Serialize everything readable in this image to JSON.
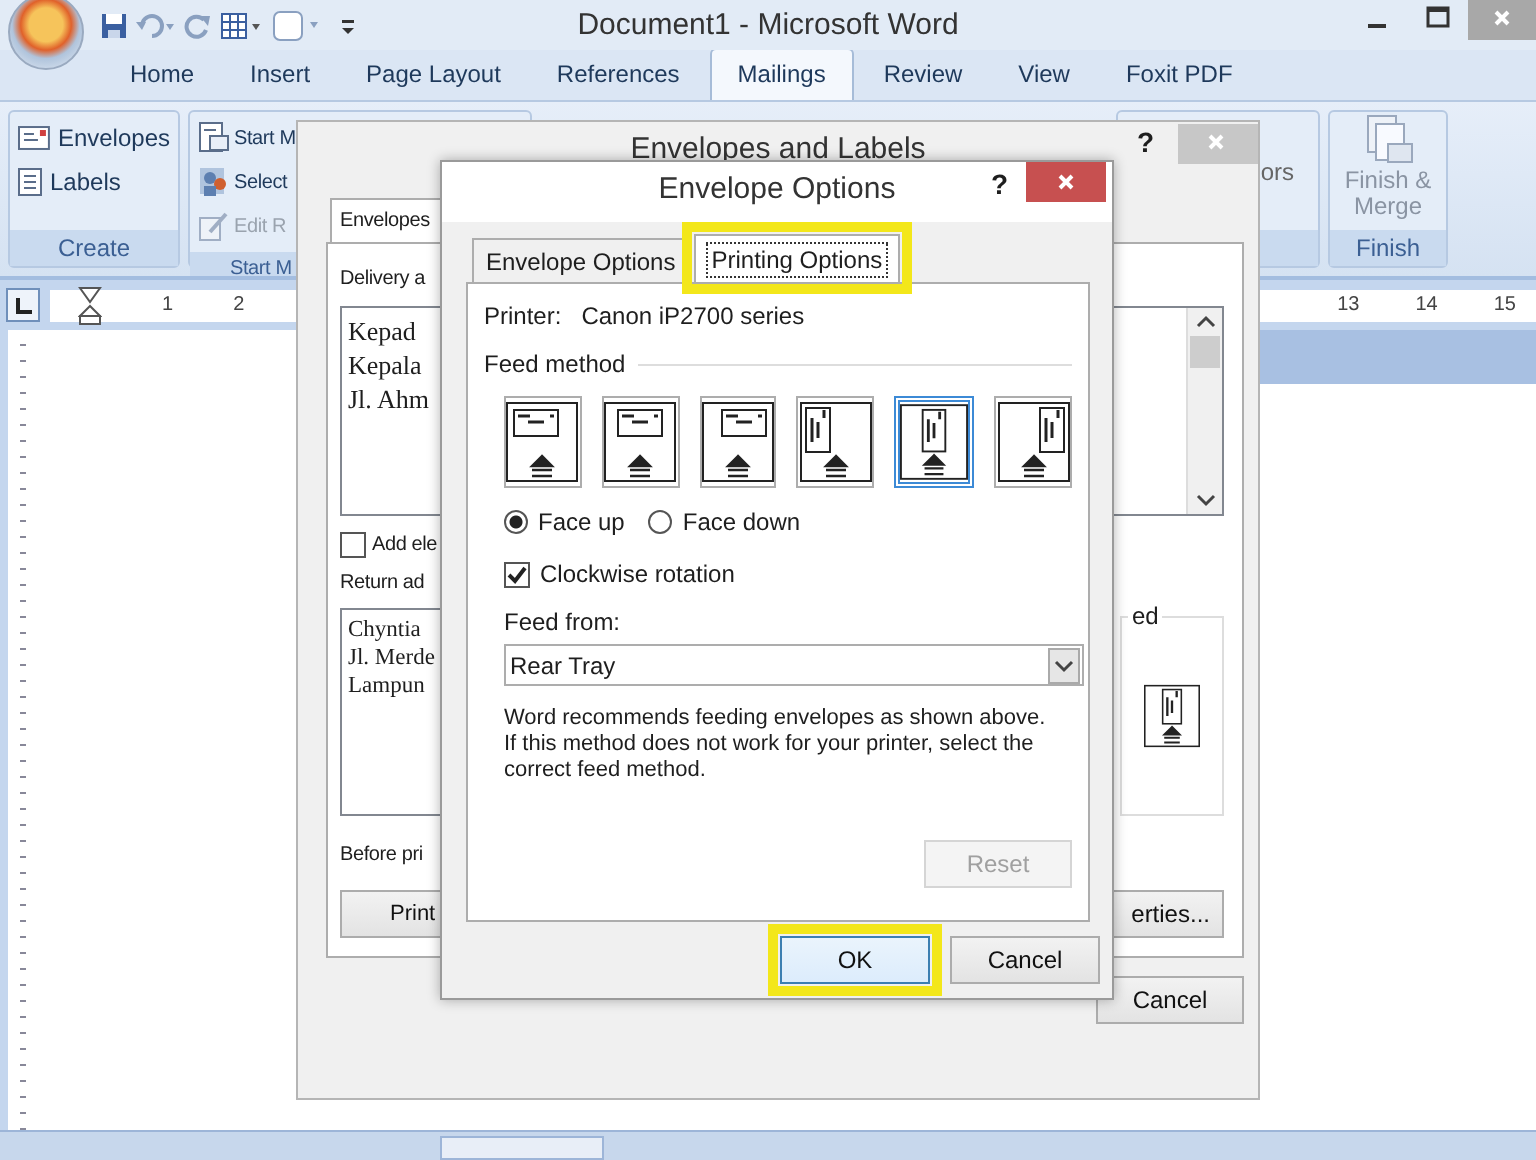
{
  "window": {
    "title": "Document1 - Microsoft Word"
  },
  "ribbon_tabs": [
    {
      "label": "Home",
      "selected": false
    },
    {
      "label": "Insert",
      "selected": false
    },
    {
      "label": "Page Layout",
      "selected": false
    },
    {
      "label": "References",
      "selected": false
    },
    {
      "label": "Mailings",
      "selected": true
    },
    {
      "label": "Review",
      "selected": false
    },
    {
      "label": "View",
      "selected": false
    },
    {
      "label": "Foxit PDF",
      "selected": false
    }
  ],
  "ribbon": {
    "create": {
      "label": "Create",
      "buttons": [
        {
          "label": "Envelopes",
          "disabled": false,
          "kind": "envelope"
        },
        {
          "label": "Labels",
          "disabled": false,
          "kind": "labels"
        }
      ]
    },
    "start": {
      "label": "Start M",
      "buttons": [
        {
          "label": "Start M",
          "disabled": false,
          "kind": "document"
        },
        {
          "label": "Select",
          "disabled": false,
          "kind": "people"
        },
        {
          "label": "Edit R",
          "disabled": true,
          "kind": "edit"
        }
      ]
    },
    "partial_group": "ors",
    "finish": {
      "label": "Finish",
      "button": "Finish & Merge"
    }
  },
  "ruler": {
    "left_numbers": [
      "1",
      "2"
    ],
    "right_numbers": [
      "13",
      "14",
      "15"
    ]
  },
  "back_dialog": {
    "title": "Envelopes and Labels",
    "help": "?",
    "tab": "Envelopes",
    "delivery_label": "Delivery a",
    "delivery_lines": [
      "Kepad",
      "Kepala",
      "Jl. Ahm"
    ],
    "add_checkbox": {
      "label": "Add ele",
      "checked": false
    },
    "return_label": "Return ad",
    "return_lines": [
      "Chyntia",
      "Jl. Merde",
      "Lampun"
    ],
    "feed_label": "ed",
    "before_label": "Before pri",
    "print_button": "Print",
    "properties_button": "erties...",
    "cancel_button": "Cancel"
  },
  "dialog": {
    "title": "Envelope Options",
    "help": "?",
    "tabs": [
      {
        "label": "Envelope Options",
        "selected": false,
        "highlighted": false
      },
      {
        "label": "Printing Options",
        "selected": true,
        "highlighted": true
      }
    ],
    "printer_label": "Printer:",
    "printer": "Canon iP2700 series",
    "feed_method_label": "Feed method",
    "feed_methods": [
      {
        "kind": "landscape_left",
        "selected": false
      },
      {
        "kind": "landscape_center",
        "selected": false
      },
      {
        "kind": "landscape_right",
        "selected": false
      },
      {
        "kind": "portrait_left",
        "selected": false
      },
      {
        "kind": "portrait_center",
        "selected": true
      },
      {
        "kind": "portrait_right",
        "selected": false
      }
    ],
    "faces": [
      {
        "label": "Face up",
        "selected": true
      },
      {
        "label": "Face down",
        "selected": false
      }
    ],
    "clockwise": {
      "label": "Clockwise rotation",
      "checked": true
    },
    "feed_from_label": "Feed from:",
    "feed_from": "Rear Tray",
    "note": "Word recommends feeding envelopes as shown above. If this method does not work for your printer, select the correct feed method.",
    "reset": {
      "label": "Reset",
      "disabled": true
    },
    "buttons": [
      {
        "label": "OK",
        "highlighted": true
      },
      {
        "label": "Cancel",
        "highlighted": false
      }
    ]
  }
}
